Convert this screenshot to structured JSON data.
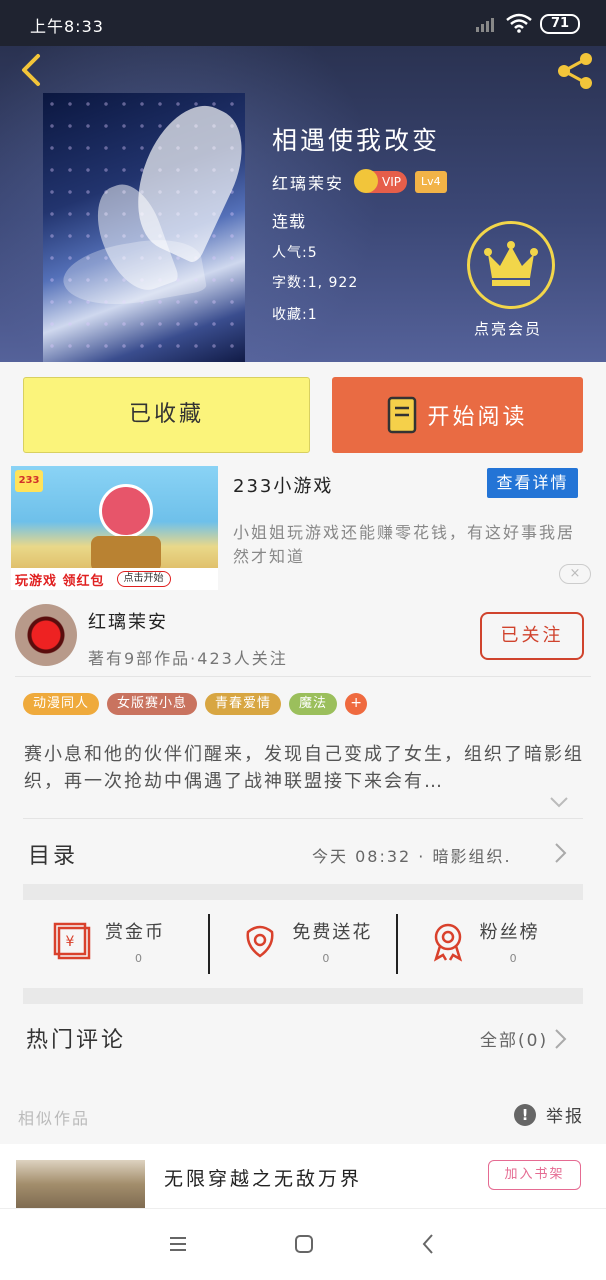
{
  "status_bar": {
    "time": "上午8:33",
    "battery": "71"
  },
  "book": {
    "title": "相遇使我改变",
    "author": "红璃茉安",
    "vip_label": "VIP",
    "level": "Lv4",
    "status": "连载",
    "popularity": "人气:5",
    "word_count": "字数:1, 922",
    "favorites": "收藏:1",
    "vip_member_label": "点亮会员"
  },
  "actions": {
    "favorited": "已收藏",
    "start_reading": "开始阅读"
  },
  "ad": {
    "name": "233小游戏",
    "detail_button": "查看详情",
    "description": "小姐姐玩游戏还能赚零花钱，有这好事我居然才知道",
    "banner_text": "玩游戏 领红包",
    "banner_button": "点击开始",
    "logo": "233",
    "close": "×"
  },
  "author_card": {
    "name": "红璃茉安",
    "subtitle": "著有9部作品·423人关注",
    "follow_button": "已关注"
  },
  "tags": [
    {
      "label": "动漫同人",
      "color": "#efaa3c"
    },
    {
      "label": "女版赛小息",
      "color": "#c9735f"
    },
    {
      "label": "青春爱情",
      "color": "#d8a642"
    },
    {
      "label": "魔法",
      "color": "#9bbf5c"
    }
  ],
  "tag_add": "+",
  "synopsis": "赛小息和他的伙伴们醒来，发现自己变成了女生，组织了暗影组织，再一次抢劫中偶遇了战神联盟接下来会有…",
  "toc": {
    "label": "目录",
    "latest": "今天 08:32 · 暗影组织."
  },
  "stats": [
    {
      "label": "赏金币",
      "value": "0"
    },
    {
      "label": "免费送花",
      "value": "0"
    },
    {
      "label": "粉丝榜",
      "value": "0"
    }
  ],
  "comments": {
    "label": "热门评论",
    "all": "全部(0)"
  },
  "similar": {
    "label": "相似作品",
    "report": "举报",
    "report_icon": "!",
    "items": [
      {
        "title": "无限穿越之无敌万界",
        "add_button": "加入书架"
      }
    ]
  },
  "colors": {
    "accent_orange": "#e96b43",
    "fav_yellow": "#fbf47b",
    "follow_red": "#d0432d",
    "ad_blue": "#2374d6",
    "vip_gold": "#f2d64a"
  }
}
